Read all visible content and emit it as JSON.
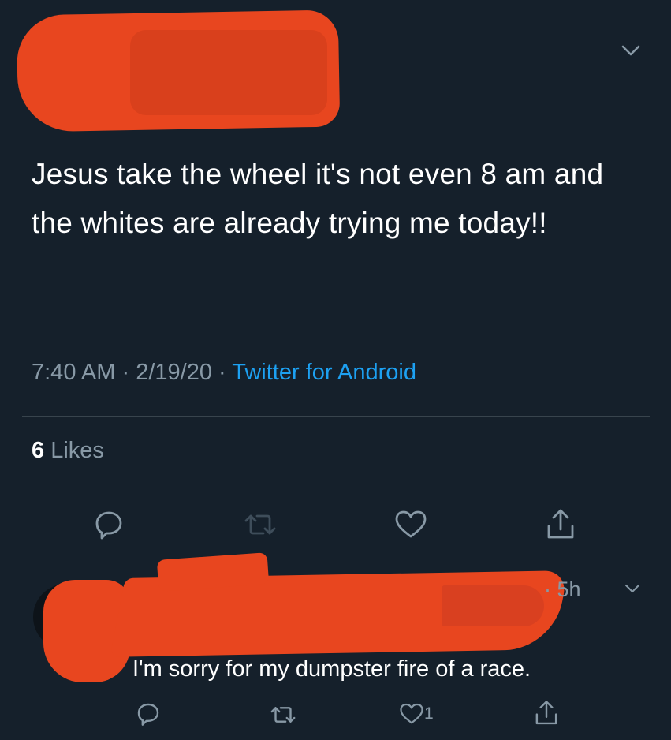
{
  "tweet": {
    "text": "Jesus take the wheel it's not even 8 am and the whites are already trying me today!!",
    "time": "7:40 AM",
    "sep1": "·",
    "date": "2/19/20",
    "sep2": "·",
    "source": "Twitter for Android",
    "likes_count": "6",
    "likes_label": "Likes",
    "author_redacted": true
  },
  "reply": {
    "time_prefix": "·",
    "time": "5h",
    "text": "I'm sorry for my dumpster fire of a race.",
    "like_count": "1",
    "author_redacted": true
  },
  "colors": {
    "background": "#15202b",
    "text": "#ffffff",
    "muted": "#8899a6",
    "link": "#1da1f2",
    "divider": "#38444d",
    "redaction": "#e8461f"
  },
  "icons": {
    "reply": "speech-bubble-icon",
    "retweet": "retweet-icon",
    "like": "heart-icon",
    "share": "share-icon",
    "caret": "chevron-down-icon"
  }
}
